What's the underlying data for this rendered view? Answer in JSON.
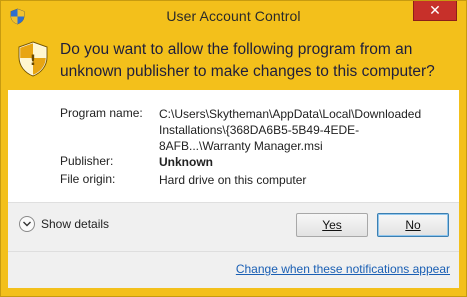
{
  "window": {
    "title": "User Account Control",
    "close_label": "✕"
  },
  "header": {
    "question": "Do you want to allow the following program from an unknown publisher to make changes to this computer?"
  },
  "details": {
    "program_name_label": "Program name:",
    "program_name_value": "C:\\Users\\Skytheman\\AppData\\Local\\Downloaded Installations\\{368DA6B5-5B49-4EDE-8AFB...\\Warranty Manager.msi",
    "publisher_label": "Publisher:",
    "publisher_value": "Unknown",
    "file_origin_label": "File origin:",
    "file_origin_value": "Hard drive on this computer"
  },
  "footer": {
    "show_details_label": "Show details",
    "yes_label": "Yes",
    "no_label": "No",
    "change_link": "Change when these notifications appear"
  },
  "icons": {
    "title_icon": "uac-shield-icon",
    "header_icon": "uac-shield-icon",
    "toggle_icon": "chevron-down-icon"
  },
  "colors": {
    "header_bg": "#f3c01b",
    "close_bg": "#c7302a",
    "link": "#1a5fb4"
  }
}
